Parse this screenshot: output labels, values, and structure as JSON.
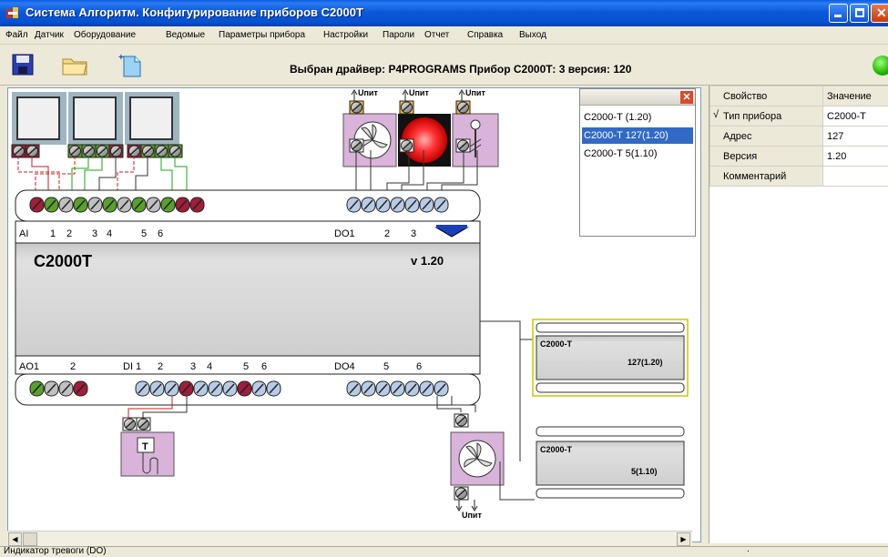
{
  "window": {
    "title": "Система Алгоритм. Конфигурирование приборов С2000Т"
  },
  "menu": [
    "Файл",
    "Датчик",
    "Оборудование",
    "Ведомые",
    "Параметры прибора",
    "Настройки",
    "Пароли",
    "Отчет",
    "Справка",
    "Выход"
  ],
  "toolbar": {
    "driver_text": "Выбран драйвер: P4PROGRAMS Прибор С2000Т: 3 версия: 120",
    "save_icon": "floppy-icon",
    "open_icon": "folder-icon",
    "new_icon": "new-document-icon"
  },
  "device": {
    "name": "C2000T",
    "version": "v 1.20",
    "top_labels": [
      "AI",
      "1",
      "2",
      "3",
      "4",
      "5",
      "6",
      "DO1",
      "2",
      "3"
    ],
    "bottom_labels": [
      "AO1",
      "2",
      "DI 1",
      "2",
      "3",
      "4",
      "5",
      "6",
      "DO4",
      "5",
      "6"
    ],
    "power_label": "Uпит"
  },
  "slaves": [
    {
      "name": "C2000-T",
      "detail": "127(1.20)"
    },
    {
      "name": "C2000-T",
      "detail": "5(1.10)"
    }
  ],
  "device_list": {
    "items": [
      "C2000-T (1.20)",
      "C2000-T 127(1.20)",
      "C2000-T 5(1.10)"
    ],
    "selected_index": 1
  },
  "properties": {
    "header": {
      "property": "Свойство",
      "value": "Значение"
    },
    "rows": [
      {
        "property": "Тип прибора",
        "value": "C2000-T",
        "checked": "√"
      },
      {
        "property": "Адрес",
        "value": "127",
        "checked": ""
      },
      {
        "property": "Версия",
        "value": "1.20",
        "checked": ""
      },
      {
        "property": "Комментарий",
        "value": "",
        "checked": ""
      }
    ]
  },
  "status": {
    "text": "Индикатор тревоги (DO)",
    "right": "."
  },
  "colors": {
    "title_blue": "#0a58d8",
    "selection": "#316ac5",
    "device_panel": "#dcdcdc",
    "device_lilac": "#d9b3d9",
    "wire_red": "#d21e1e",
    "wire_green": "#18a418",
    "wire_dark": "#333333"
  }
}
